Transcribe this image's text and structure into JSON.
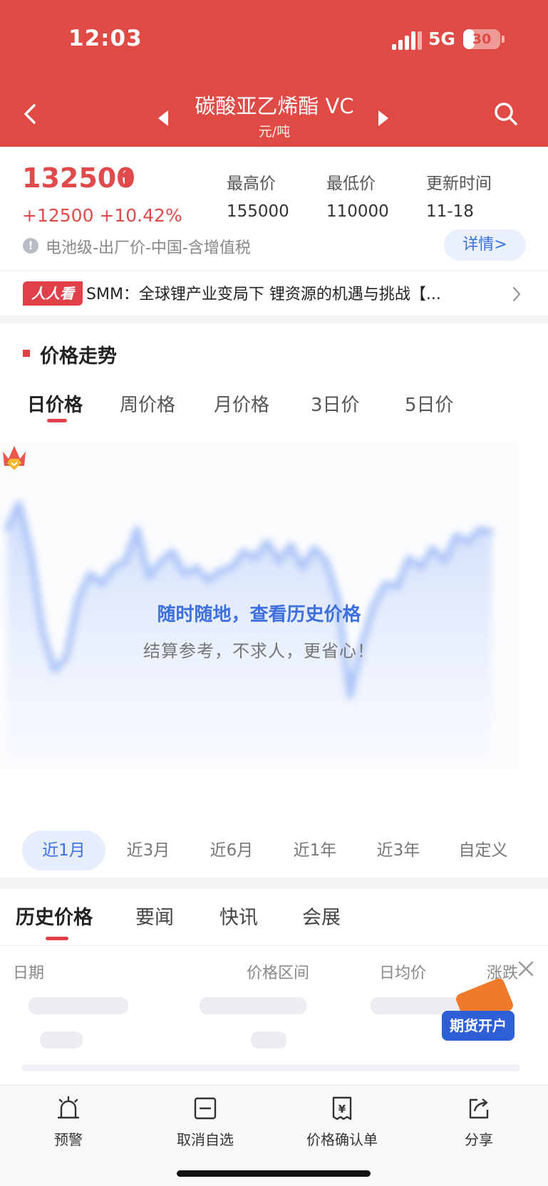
{
  "status_bar": {
    "time": "12:03",
    "network": "5G",
    "battery": "30",
    "battery_fraction": 0.3
  },
  "header": {
    "title": "碳酸亚乙烯酯 VC",
    "unit": "元/吨"
  },
  "price": {
    "current": "132500",
    "change": "+12500 +10.42%",
    "stats": [
      {
        "label": "最高价",
        "value": "155000"
      },
      {
        "label": "最低价",
        "value": "110000"
      },
      {
        "label": "更新时间",
        "value": "11-18"
      }
    ],
    "note": "电池级-出厂价-中国-含增值税",
    "detail_button": "详情>"
  },
  "news": {
    "tag": "人人看",
    "headline": "SMM：全球锂产业变局下 锂资源的机遇与挑战【..."
  },
  "trend": {
    "title": "价格走势",
    "period_tabs": [
      "日价格",
      "周价格",
      "月价格",
      "3日价",
      "5日价"
    ],
    "overlay_title": "随时随地，查看历史价格",
    "overlay_subtitle": "结算参考，不求人，更省心！",
    "range_tabs": [
      "近1月",
      "近3月",
      "近6月",
      "近1年",
      "近3年",
      "自定义"
    ]
  },
  "info": {
    "tabs": [
      "历史价格",
      "要闻",
      "快讯",
      "会展"
    ],
    "table_headers": [
      "日期",
      "价格区间",
      "日均价",
      "涨跌"
    ],
    "promo_label": "期货开户"
  },
  "toolbar": [
    "预警",
    "取消自选",
    "价格确认单",
    "分享"
  ],
  "colors": {
    "header": "#e04a44",
    "price_up": "#e14a4a",
    "accent_blue": "#3d6fe0"
  },
  "chart_data": {
    "type": "area",
    "blurred": true,
    "values": [
      62,
      70,
      55,
      30,
      18,
      22,
      40,
      48,
      45,
      50,
      52,
      62,
      47,
      52,
      55,
      48,
      50,
      46,
      49,
      50,
      55,
      53,
      58,
      52,
      57,
      50,
      56,
      52,
      40,
      10,
      26,
      38,
      45,
      44,
      53,
      50,
      56,
      52,
      60,
      58,
      62,
      61
    ]
  }
}
